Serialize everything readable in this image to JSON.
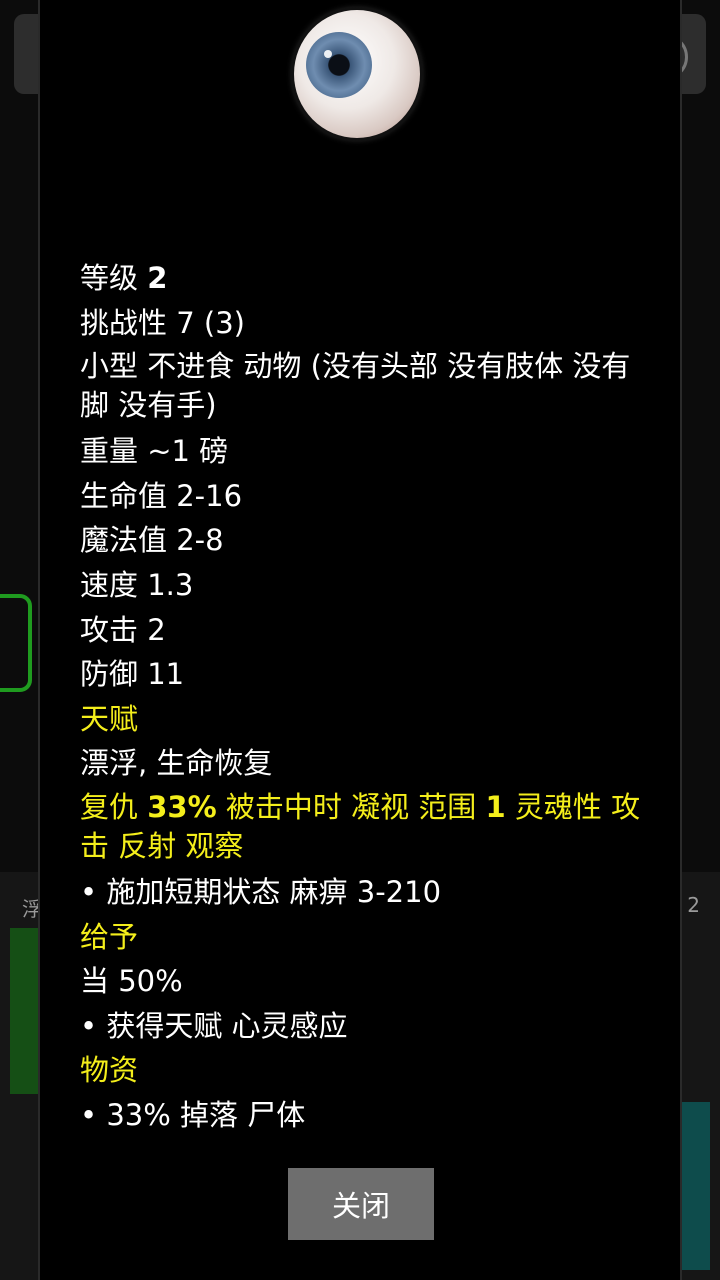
{
  "background": {
    "left_label": "浮",
    "right_label": "2"
  },
  "portrait_icon": "eyeball-icon",
  "stats": {
    "level_label": "等级",
    "level_value": "2",
    "challenge": "挑战性 7 (3)",
    "type_line": "小型 不进食 动物 (没有头部 没有肢体 没有脚 没有手)",
    "weight": "重量 ~1 磅",
    "hp": "生命值 2-16",
    "mp": "魔法值 2-8",
    "speed": "速度 1.3",
    "attack": "攻击 2",
    "defense": "防御 11"
  },
  "talent": {
    "header": "天赋",
    "list": "漂浮, 生命恢复",
    "revenge_1": "复仇 ",
    "revenge_pct": "33%",
    "revenge_2": " 被击中时 凝视 范围 ",
    "revenge_range": "1",
    "revenge_3": " 灵魂性 攻击 反射 观察",
    "effect": "• 施加短期状态 麻痹 3-210"
  },
  "grant": {
    "header": "给予",
    "chance": "当 50%",
    "effect": "• 获得天赋 心灵感应"
  },
  "loot": {
    "header": "物资",
    "item": "• 33% 掉落 尸体"
  },
  "close_label": "关闭",
  "colors": {
    "highlight": "#f4ee1b",
    "text": "#ffffff",
    "button": "#6e6e6e"
  }
}
